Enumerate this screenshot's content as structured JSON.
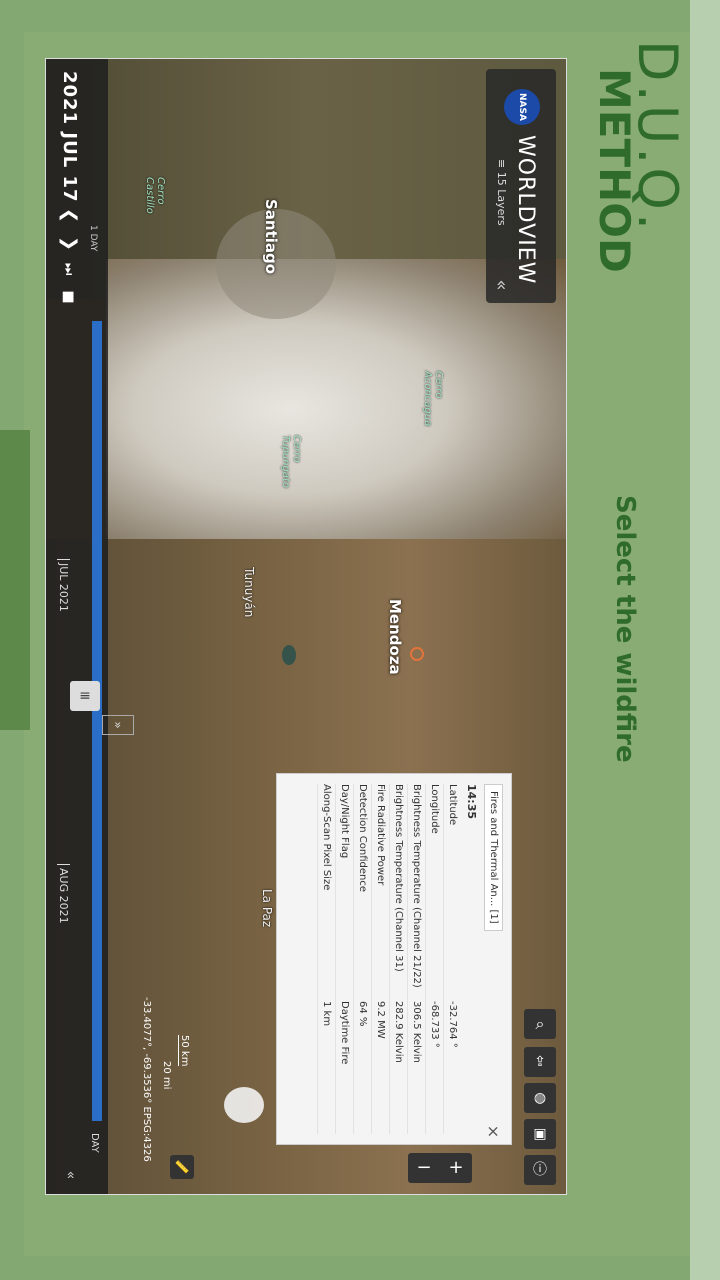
{
  "brand": {
    "title_line1": "D.U.Q.",
    "title_line2": "METHOD",
    "instruction": "Select the wildfire"
  },
  "worldview": {
    "app_name": "WORLDVIEW",
    "nasa_badge": "NASA",
    "layers_label": "15 Layers"
  },
  "map": {
    "labels": {
      "santiago": "Santiago",
      "mendoza": "Mendoza",
      "tunuyan": "Tunuyán",
      "la_paz": "La Paz",
      "cerro_aconcagua": "Cerro Aconcagua",
      "cerro_tupungato": "Cerro Tupungato",
      "cerro_castillo": "Cerro Castillo"
    },
    "coordinates": "-33.4077°, -69.3536°",
    "projection": "EPSG:4326",
    "scale_km": "50 km",
    "scale_mi": "20 mi"
  },
  "timeline": {
    "date_year": "2021",
    "date_month": "JUL",
    "date_day": "17",
    "interval": "1 DAY",
    "month_label_1": "JUL 2021",
    "month_label_2": "AUG 2021",
    "zoom_label": "DAY"
  },
  "popup": {
    "title": "Fires and Thermal An... [1]",
    "time": "14:35",
    "rows": [
      {
        "label": "Latitude",
        "value": "-32.764 °"
      },
      {
        "label": "Longitude",
        "value": "-68.733 °"
      },
      {
        "label": "Brightness Temperature (Channel 21/22)",
        "value": "306.5 Kelvin"
      },
      {
        "label": "Brightness Temperature (Channel 31)",
        "value": "282.9 Kelvin"
      },
      {
        "label": "Fire Radiative Power",
        "value": "9.2 MW"
      },
      {
        "label": "Detection Confidence",
        "value": "64 %"
      },
      {
        "label": "Day/Night Flag",
        "value": "Daytime Fire"
      },
      {
        "label": "Along-Scan Pixel Size",
        "value": "1 km"
      }
    ],
    "close": "×"
  },
  "zoom": {
    "plus": "+",
    "minus": "−"
  },
  "colors": {
    "green_bg": "#6b9a5a",
    "title_green": "#2f6b2a",
    "fire_marker": "#e2733a",
    "timeline_blue": "#2a6ec7"
  }
}
